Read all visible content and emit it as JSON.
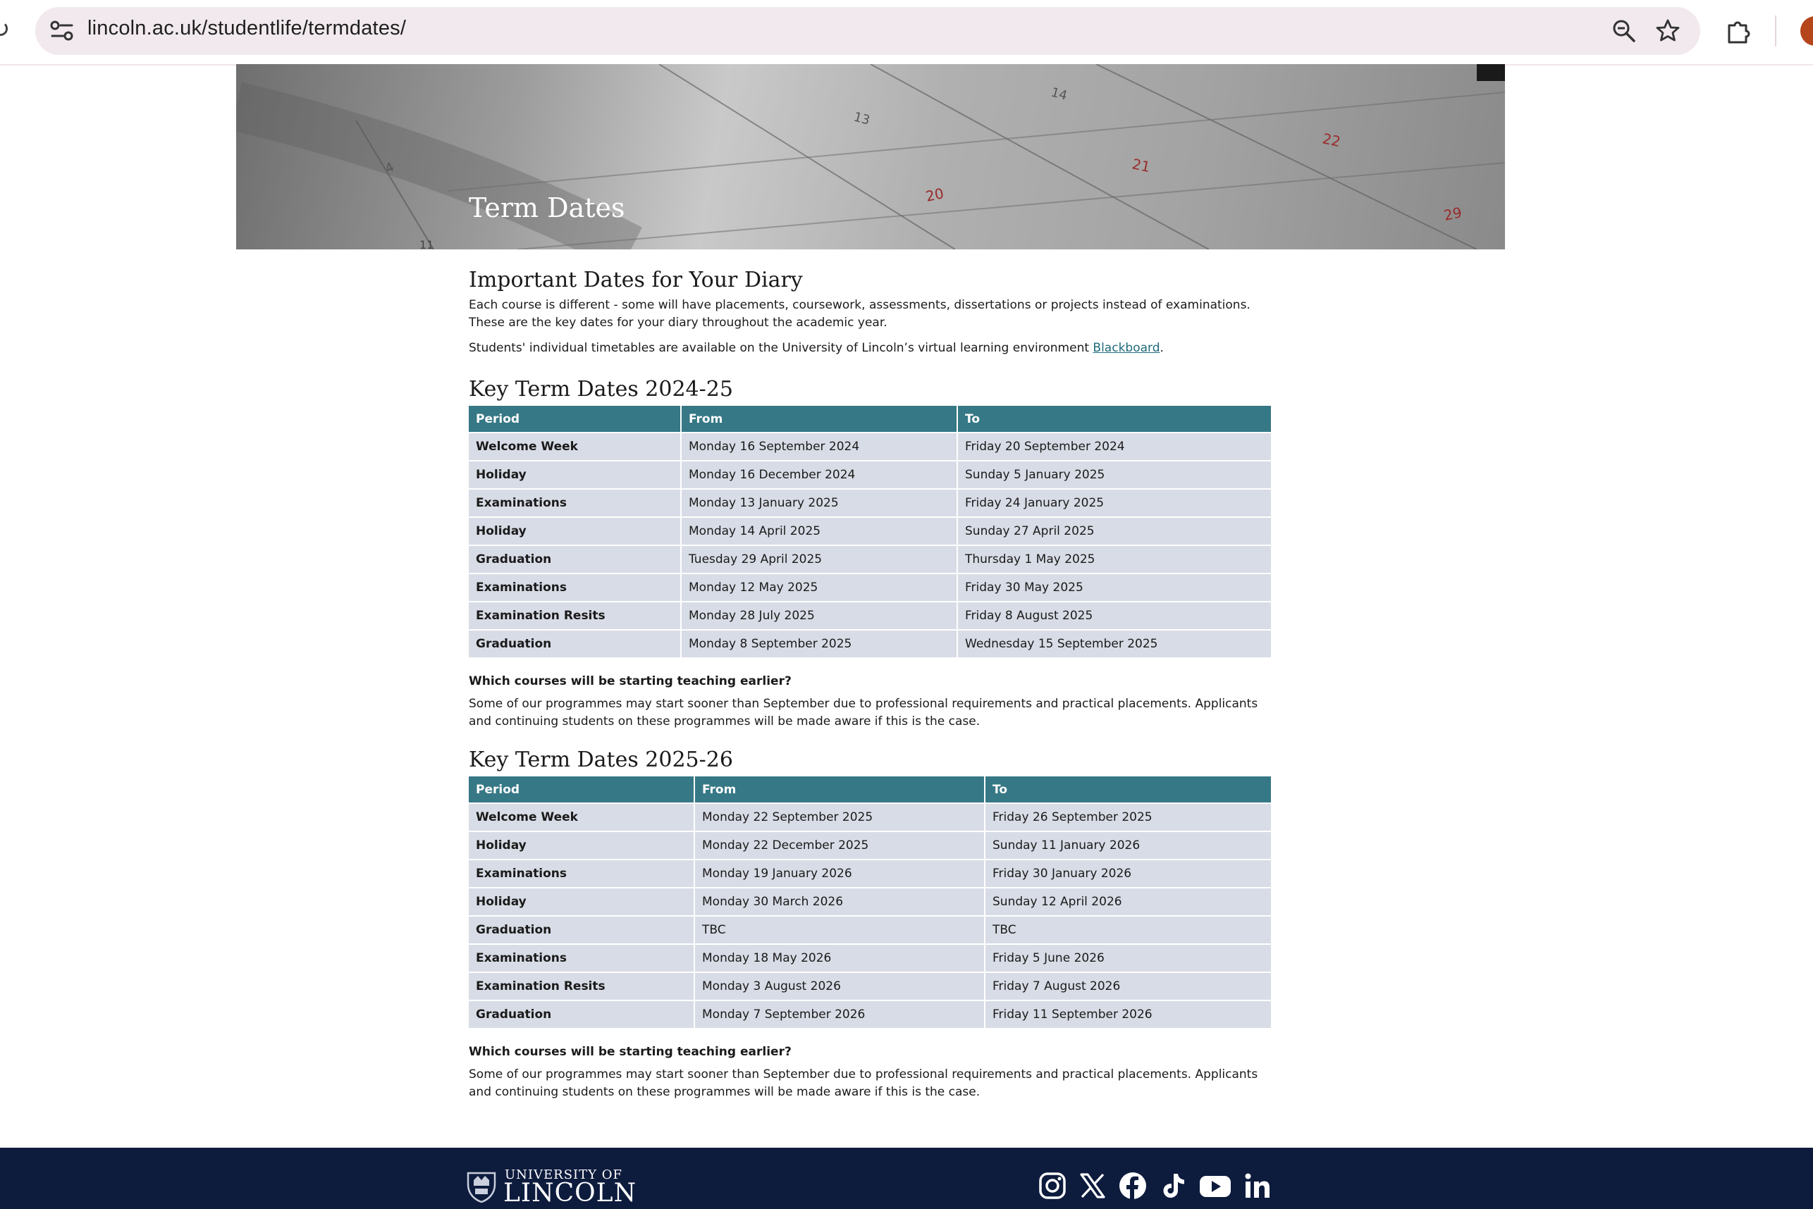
{
  "browser": {
    "url_host": "lincoln.ac.uk",
    "url_path": "/studentlife/termdates/",
    "icons": [
      "reload-icon",
      "site-info-icon",
      "zoom-icon",
      "bookmark-star-icon",
      "extensions-icon",
      "profile-avatar"
    ]
  },
  "hero": {
    "title": "Term Dates",
    "calendar_numbers": [
      "4",
      "13",
      "14",
      "20",
      "21",
      "22",
      "29",
      "11"
    ]
  },
  "intro": {
    "heading": "Important Dates for Your Diary",
    "paragraph1": "Each course is different - some will have placements, coursework, assessments, dissertations or projects instead of examinations. These are the key dates for your diary throughout the academic year.",
    "paragraph2_prefix": "Students' individual timetables are available on the University of Lincoln’s virtual learning environment ",
    "paragraph2_link": "Blackboard",
    "paragraph2_suffix": "."
  },
  "tables": [
    {
      "heading": "Key Term Dates 2024-25",
      "headers": [
        "Period",
        "From",
        "To"
      ],
      "rows": [
        [
          "Welcome Week",
          "Monday 16 September 2024",
          "Friday 20 September 2024"
        ],
        [
          "Holiday",
          "Monday 16 December 2024",
          "Sunday 5 January 2025"
        ],
        [
          "Examinations",
          "Monday 13 January 2025",
          "Friday 24 January 2025"
        ],
        [
          "Holiday",
          "Monday 14 April 2025",
          "Sunday 27 April 2025"
        ],
        [
          "Graduation",
          "Tuesday 29 April 2025",
          "Thursday 1 May 2025"
        ],
        [
          "Examinations",
          "Monday 12 May 2025",
          "Friday 30 May 2025"
        ],
        [
          "Examination Resits",
          "Monday 28 July 2025",
          "Friday 8 August 2025"
        ],
        [
          "Graduation",
          "Monday 8 September 2025",
          "Wednesday 15 September 2025"
        ]
      ],
      "question": "Which courses will be starting teaching earlier?",
      "answer": "Some of our programmes may start sooner than September due to professional requirements and practical placements. Applicants and continuing students on these programmes will be made aware if this is the case."
    },
    {
      "heading": "Key Term Dates 2025-26",
      "headers": [
        "Period",
        "From",
        "To"
      ],
      "rows": [
        [
          "Welcome Week",
          "Monday 22 September 2025",
          "Friday 26 September 2025"
        ],
        [
          "Holiday",
          "Monday 22 December 2025",
          "Sunday 11 January 2026"
        ],
        [
          "Examinations",
          "Monday 19 January 2026",
          "Friday 30 January 2026"
        ],
        [
          "Holiday",
          "Monday 30 March 2026",
          "Sunday 12 April 2026"
        ],
        [
          "Graduation",
          "TBC",
          "TBC"
        ],
        [
          "Examinations",
          "Monday 18 May 2026",
          "Friday 5 June 2026"
        ],
        [
          "Examination Resits",
          "Monday 3 August 2026",
          "Friday 7 August 2026"
        ],
        [
          "Graduation",
          "Monday 7 September 2026",
          "Friday 11 September 2026"
        ]
      ],
      "question": "Which courses will be starting teaching earlier?",
      "answer": "Some of our programmes may start sooner than September due to professional requirements and practical placements. Applicants and continuing students on these programmes will be made aware if this is the case."
    }
  ],
  "footer": {
    "logo_small": "UNIVERSITY OF",
    "logo_big": "LINCOLN",
    "social": [
      "instagram-icon",
      "x-icon",
      "facebook-icon",
      "tiktok-icon",
      "youtube-icon",
      "linkedin-icon"
    ]
  },
  "colors": {
    "table_header": "#367886",
    "table_cell": "#d8dce6",
    "footer_bg": "#0d1b3d",
    "link": "#1f6b7a"
  }
}
